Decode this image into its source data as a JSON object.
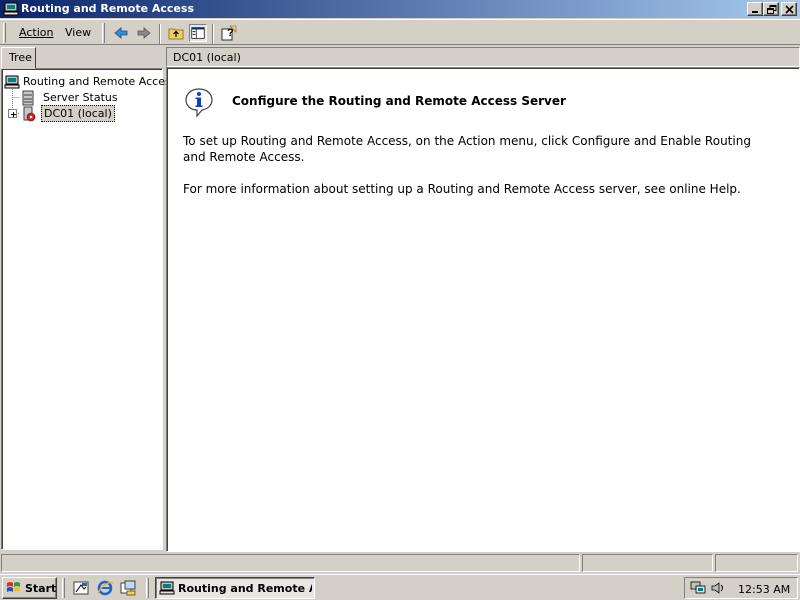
{
  "window": {
    "title": "Routing and Remote Access",
    "app_icon": "rras-icon",
    "controls": [
      "minimize-icon",
      "restore-icon",
      "close-icon"
    ]
  },
  "menu": {
    "action": "Action",
    "view": "View"
  },
  "toolbar": {
    "buttons": [
      "back-arrow-icon",
      "forward-arrow-icon",
      "up-folder-icon",
      "show-hide-tree-icon",
      "help-icon"
    ]
  },
  "tree": {
    "tab_label": "Tree",
    "items": [
      {
        "label": "Routing and Remote Access",
        "icon": "rras-icon"
      },
      {
        "label": "Server Status",
        "icon": "server-status-icon"
      },
      {
        "label": "DC01 (local)",
        "icon": "server-stopped-icon",
        "selected": true
      }
    ]
  },
  "result": {
    "header": "DC01 (local)",
    "heading": "Configure the Routing and Remote Access Server",
    "paragraph1": "To set up Routing and Remote Access, on the Action menu, click Configure and Enable Routing and Remote Access.",
    "paragraph2": "For more information about setting up a Routing and Remote Access server, see online Help."
  },
  "taskbar": {
    "start_label": "Start",
    "task_label": "Routing and Remote A...",
    "clock": "12:53 AM",
    "quick_launch": [
      "show-desktop-icon",
      "internet-explorer-icon",
      "explorer-icon"
    ],
    "tray_icons": [
      "network-icon",
      "volume-icon"
    ]
  },
  "colors": {
    "titlebar_start": "#0a246a",
    "titlebar_end": "#a6caf0",
    "face": "#d4d0c8"
  }
}
